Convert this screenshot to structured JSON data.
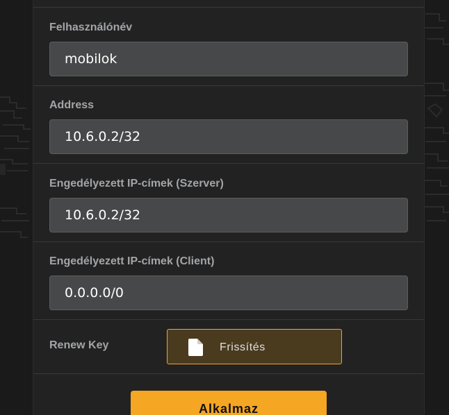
{
  "form": {
    "username": {
      "label": "Felhasználónév",
      "value": "mobilok"
    },
    "address": {
      "label": "Address",
      "value": "10.6.0.2/32"
    },
    "allowed_ips_server": {
      "label": "Engedélyezett IP-címek (Szerver)",
      "value": "10.6.0.2/32"
    },
    "allowed_ips_client": {
      "label": "Engedélyezett IP-címek (Client)",
      "value": "0.0.0.0/0"
    },
    "renew_key": {
      "label": "Renew Key",
      "button_label": "Frissítés",
      "button_icon": "file-icon"
    }
  },
  "actions": {
    "apply_label": "Alkalmaz"
  },
  "colors": {
    "accent": "#f5a623",
    "panel": "#222222",
    "input_bg": "#474849"
  }
}
